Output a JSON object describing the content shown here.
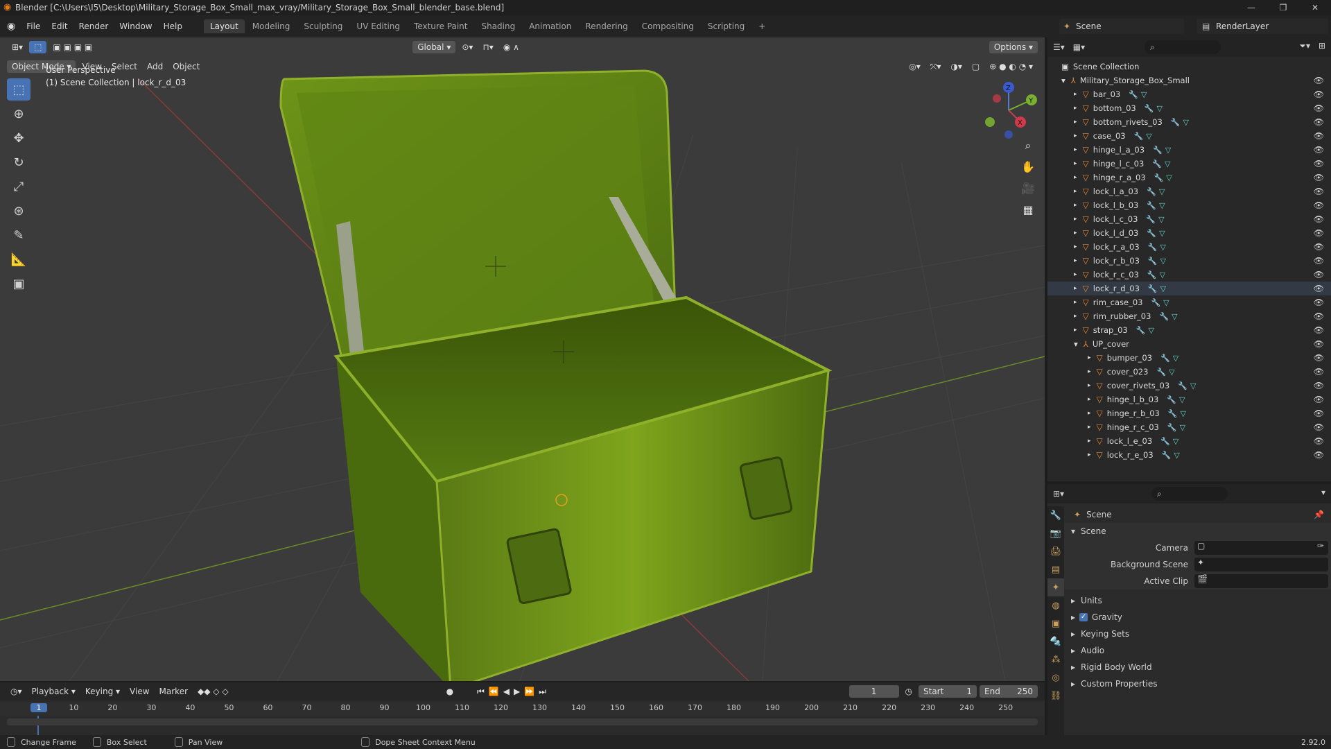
{
  "titlebar": {
    "title": "Blender [C:\\Users\\I5\\Desktop\\Military_Storage_Box_Small_max_vray/Military_Storage_Box_Small_blender_base.blend]",
    "min": "—",
    "max": "❐",
    "close": "✕"
  },
  "menu": [
    "File",
    "Edit",
    "Render",
    "Window",
    "Help"
  ],
  "workspaces": [
    "Layout",
    "Modeling",
    "Sculpting",
    "UV Editing",
    "Texture Paint",
    "Shading",
    "Animation",
    "Rendering",
    "Compositing",
    "Scripting"
  ],
  "add_workspace": "+",
  "scene_name": "Scene",
  "render_layer": "RenderLayer",
  "viewport": {
    "mode": "Object Mode",
    "menus": [
      "View",
      "Select",
      "Add",
      "Object"
    ],
    "transform": "Global",
    "options": "Options",
    "info_line1": "User Perspective",
    "info_line2": "(1) Scene Collection | lock_r_d_03",
    "axes": {
      "x": "X",
      "y": "Y",
      "z": "Z"
    }
  },
  "outliner": {
    "root": "Scene Collection",
    "collection": "Military_Storage_Box_Small",
    "objects": [
      "bar_03",
      "bottom_03",
      "bottom_rivets_03",
      "case_03",
      "hinge_l_a_03",
      "hinge_l_c_03",
      "hinge_r_a_03",
      "lock_l_a_03",
      "lock_l_b_03",
      "lock_l_c_03",
      "lock_l_d_03",
      "lock_r_a_03",
      "lock_r_b_03",
      "lock_r_c_03",
      "lock_r_d_03",
      "rim_case_03",
      "rim_rubber_03",
      "strap_03"
    ],
    "subgroup": "UP_cover",
    "sub_objects": [
      "bumper_03",
      "cover_023",
      "cover_rivets_03",
      "hinge_l_b_03",
      "hinge_r_b_03",
      "hinge_r_c_03",
      "lock_l_e_03",
      "lock_r_e_03"
    ]
  },
  "properties": {
    "context": "Scene",
    "panel": "Scene",
    "camera_label": "Camera",
    "bg_scene_label": "Background Scene",
    "active_clip_label": "Active Clip",
    "sections": [
      "Units",
      "Gravity",
      "Keying Sets",
      "Audio",
      "Rigid Body World",
      "Custom Properties"
    ]
  },
  "timeline": {
    "menus": [
      "Playback",
      "Keying",
      "View",
      "Marker"
    ],
    "current_frame": "1",
    "start_label": "Start",
    "start": "1",
    "end_label": "End",
    "end": "250",
    "ticks": [
      "1",
      "10",
      "20",
      "30",
      "40",
      "50",
      "60",
      "70",
      "80",
      "90",
      "100",
      "110",
      "120",
      "130",
      "140",
      "150",
      "160",
      "170",
      "180",
      "190",
      "200",
      "210",
      "220",
      "230",
      "240",
      "250"
    ]
  },
  "status": {
    "change_frame": "Change Frame",
    "box_select": "Box Select",
    "pan_view": "Pan View",
    "context_menu": "Dope Sheet Context Menu",
    "version": "2.92.0"
  }
}
